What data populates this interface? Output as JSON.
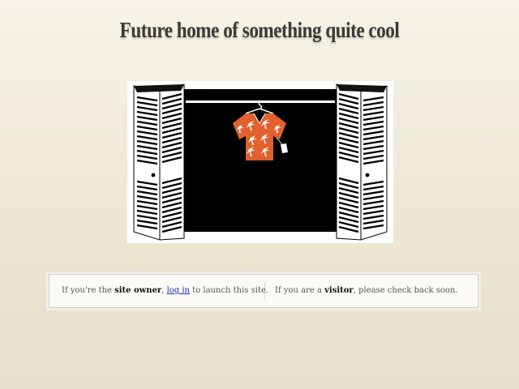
{
  "headline": "Future home of something quite cool",
  "owner_notice": {
    "prefix": "If you're the ",
    "role": "site owner",
    "comma": ", ",
    "login_link": "log in",
    "suffix": " to launch this site."
  },
  "visitor_notice": {
    "prefix": "If you are a ",
    "role": "visitor",
    "suffix": ", please check back soon."
  },
  "colors": {
    "shirt": "#e0602e",
    "closet_interior": "#000000",
    "door": "#ffffff",
    "link": "#1a2ea8"
  },
  "icons": {
    "illustration": "closet-with-hawaiian-shirt"
  }
}
